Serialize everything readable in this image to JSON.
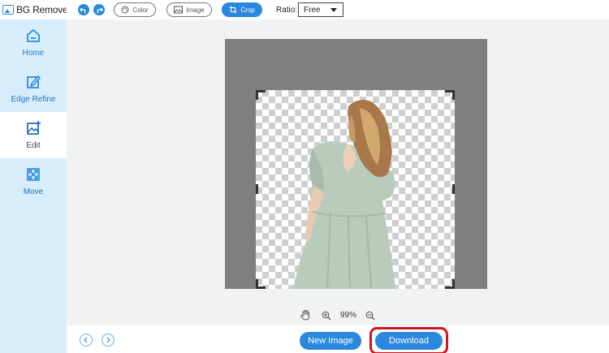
{
  "app": {
    "title": "BG Remover"
  },
  "sidebar": {
    "items": [
      {
        "id": "home",
        "label": "Home",
        "icon": "home-icon",
        "active": false
      },
      {
        "id": "edge",
        "label": "Edge Refine",
        "icon": "pencil-square-icon",
        "active": false
      },
      {
        "id": "edit",
        "label": "Edit",
        "icon": "image-edit-icon",
        "active": true
      },
      {
        "id": "move",
        "label": "Move",
        "icon": "move-arrows-icon",
        "active": false
      }
    ]
  },
  "toolbar": {
    "undo_icon": "undo-icon",
    "redo_icon": "redo-icon",
    "color_label": "Color",
    "image_label": "Image",
    "crop_label": "Crop",
    "ratio_label": "Ratio:",
    "ratio_value": "Free"
  },
  "zoom": {
    "value": "99%"
  },
  "bottom": {
    "new_image_label": "New Image",
    "download_label": "Download"
  },
  "colors": {
    "accent": "#2a89dc",
    "sidebar_bg": "#d6eefc",
    "highlight": "#d0141c"
  }
}
